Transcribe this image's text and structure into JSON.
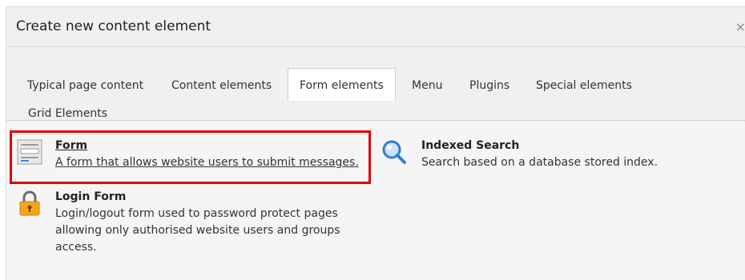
{
  "dialog": {
    "title": "Create new content element",
    "close_glyph": "×"
  },
  "tabs": [
    {
      "label": "Typical page content",
      "active": false
    },
    {
      "label": "Content elements",
      "active": false
    },
    {
      "label": "Form elements",
      "active": true
    },
    {
      "label": "Menu",
      "active": false
    },
    {
      "label": "Plugins",
      "active": false
    },
    {
      "label": "Special elements",
      "active": false
    },
    {
      "label": "Grid Elements",
      "active": false
    }
  ],
  "items": [
    {
      "icon": "form-icon",
      "title": "Form",
      "description": "A form that allows website users to submit messages.",
      "highlighted": true
    },
    {
      "icon": "search-icon",
      "title": "Indexed Search",
      "description": "Search based on a database stored index.",
      "highlighted": false
    },
    {
      "icon": "lock-icon",
      "title": "Login Form",
      "description": "Login/logout form used to password protect pages allowing only authorised website users and groups access.",
      "highlighted": false
    }
  ],
  "colors": {
    "highlight_border": "#e00000",
    "search_icon_blue": "#2f7fd1",
    "lock_icon_orange": "#f2a51d"
  }
}
